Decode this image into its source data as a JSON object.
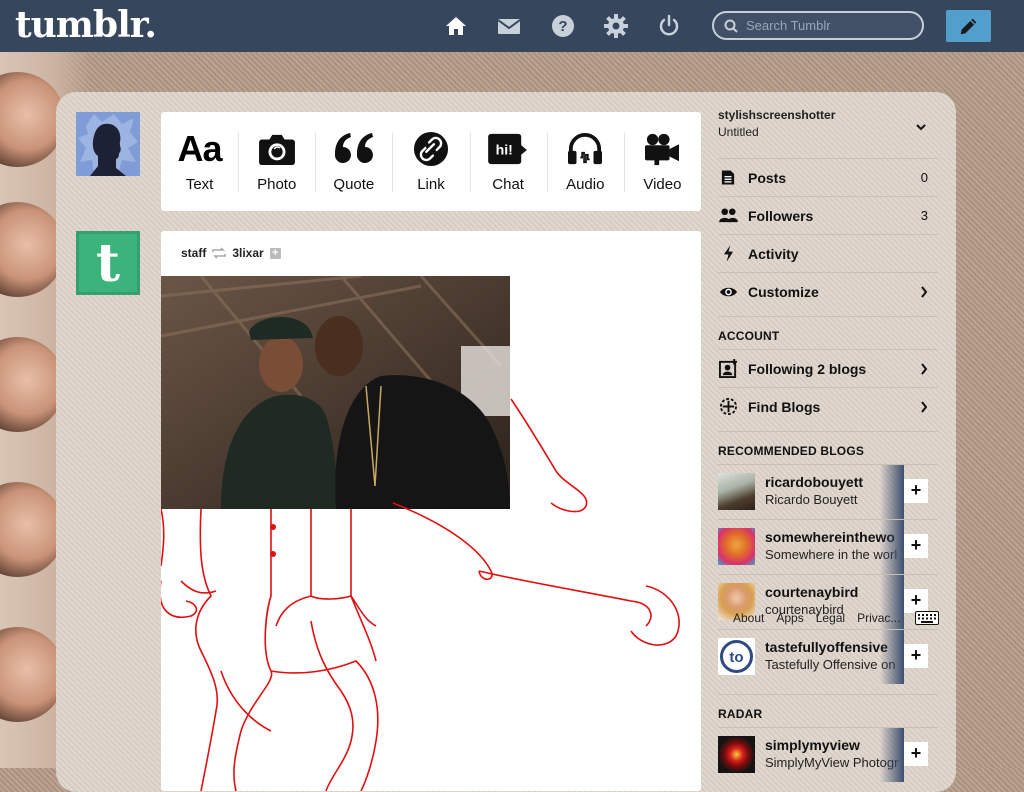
{
  "header": {
    "logo": "tumblr.",
    "search_placeholder": "Search Tumblr",
    "icons": [
      "home-icon",
      "mail-icon",
      "help-icon",
      "gear-icon",
      "power-icon"
    ],
    "compose_icon": "pencil-icon",
    "colors": {
      "bar": "#36465d",
      "compose": "#529ecc"
    }
  },
  "post_types": [
    {
      "label": "Text",
      "icon": "text-icon"
    },
    {
      "label": "Photo",
      "icon": "camera-icon"
    },
    {
      "label": "Quote",
      "icon": "quote-icon"
    },
    {
      "label": "Link",
      "icon": "link-icon"
    },
    {
      "label": "Chat",
      "icon": "chat-icon"
    },
    {
      "label": "Audio",
      "icon": "headphones-icon"
    },
    {
      "label": "Video",
      "icon": "video-camera-icon"
    }
  ],
  "post": {
    "author": "staff",
    "reblogged_from": "3lixar",
    "text_glyph": "Aa",
    "chat_glyph": "hi!"
  },
  "sidebar": {
    "blog_name": "stylishscreenshotter",
    "blog_title": "Untitled",
    "items": [
      {
        "label": "Posts",
        "count": "0",
        "icon": "document-icon"
      },
      {
        "label": "Followers",
        "count": "3",
        "icon": "people-icon"
      },
      {
        "label": "Activity",
        "icon": "lightning-icon"
      },
      {
        "label": "Customize",
        "icon": "eye-icon"
      }
    ],
    "account_title": "ACCOUNT",
    "account_items": [
      {
        "label": "Following 2 blogs",
        "icon": "add-user-icon"
      },
      {
        "label": "Find Blogs",
        "icon": "compass-icon"
      }
    ],
    "recommended_title": "RECOMMENDED BLOGS",
    "recommended": [
      {
        "name": "ricardobouyett",
        "title": "Ricardo Bouyett"
      },
      {
        "name": "somewhereinthewo",
        "title": "Somewhere in the worl"
      },
      {
        "name": "courtenaybird",
        "title": "courtenaybird"
      },
      {
        "name": "tastefullyoffensive",
        "title": "Tastefully Offensive on"
      }
    ],
    "follow_glyph": "+",
    "radar_title": "RADAR",
    "radar": [
      {
        "name": "simplymyview",
        "title": "SimplyMyView Photogr"
      }
    ]
  },
  "footer_links": [
    "About",
    "Apps",
    "Legal",
    "Privac..."
  ]
}
